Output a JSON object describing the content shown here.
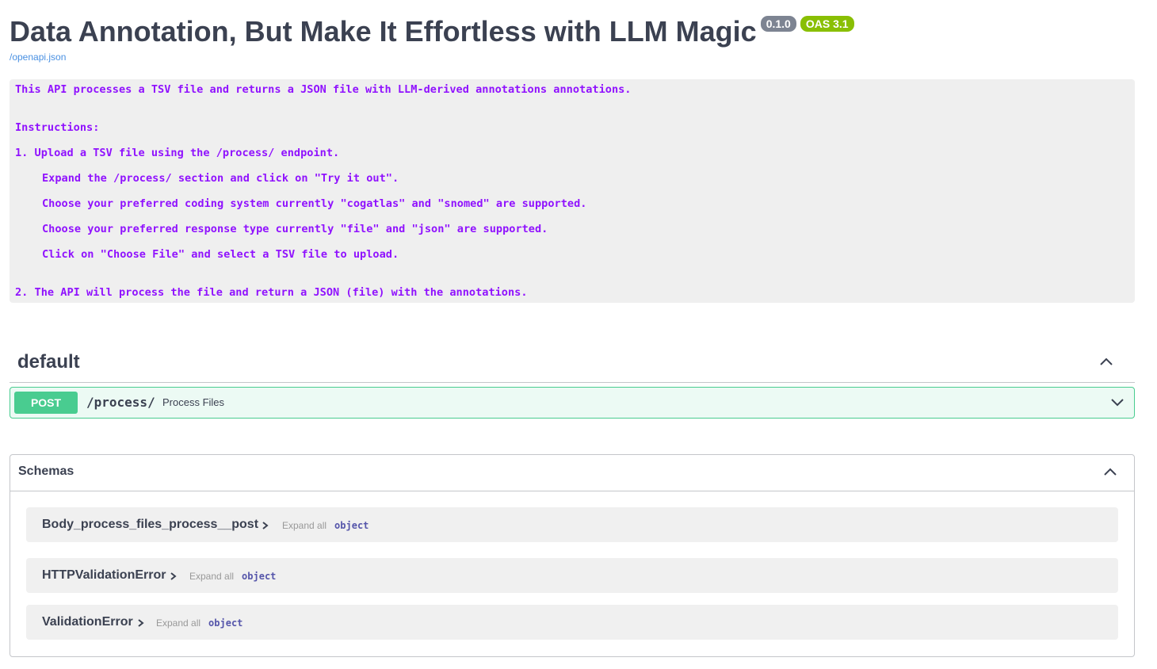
{
  "info": {
    "title": "Data Annotation, But Make It Effortless with LLM Magic",
    "version_badge": "0.1.0",
    "oas_badge": "OAS 3.1",
    "spec_link": "/openapi.json"
  },
  "description": {
    "lines": [
      "This API processes a TSV file and returns a JSON file with LLM-derived annotations annotations.",
      "Instructions:",
      "1. Upload a TSV file using the /process/ endpoint.",
      "Expand the /process/ section and click on \"Try it out\".",
      "Choose your preferred coding system currently \"cogatlas\" and \"snomed\" are supported.",
      "Choose your preferred response type currently \"file\" and \"json\" are supported.",
      "Click on \"Choose File\" and select a TSV file to upload.",
      "2. The API will process the file and return a JSON (file) with the annotations."
    ]
  },
  "section": {
    "title": "default",
    "operation": {
      "method": "POST",
      "path": "/process/",
      "summary": "Process Files"
    }
  },
  "schemas": {
    "title": "Schemas",
    "models": [
      {
        "name": "Body_process_files_process__post",
        "expand_label": "Expand all",
        "type": "object"
      },
      {
        "name": "HTTPValidationError",
        "expand_label": "Expand all",
        "type": "object"
      },
      {
        "name": "ValidationError",
        "expand_label": "Expand all",
        "type": "object"
      }
    ]
  },
  "colors": {
    "text": "#3b4151",
    "description_text": "#9012fe",
    "post": "#49cc90",
    "link": "#4990e2",
    "oas_badge": "#89bf04",
    "version_badge": "#7d8492"
  }
}
